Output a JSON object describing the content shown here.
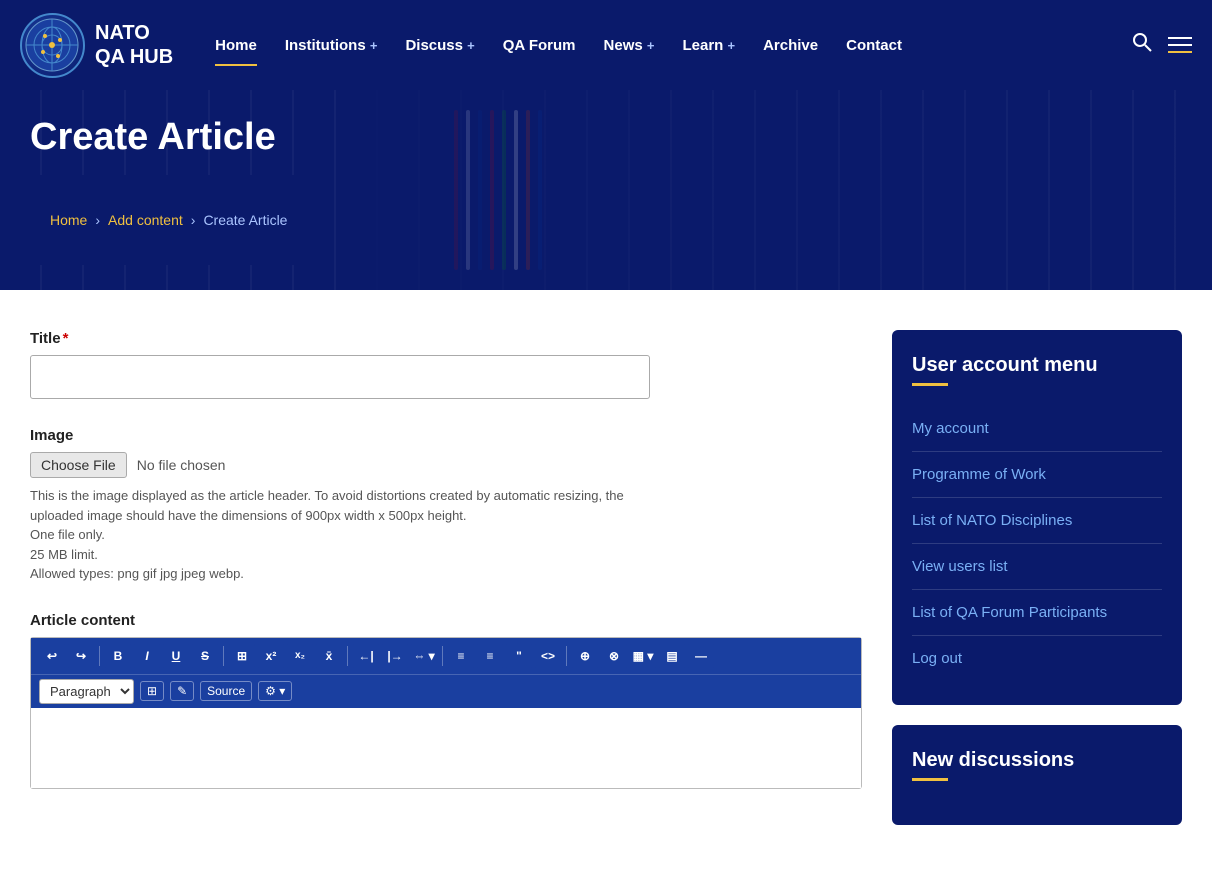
{
  "nav": {
    "logo_text_line1": "NATO",
    "logo_text_line2": "QA  HUB",
    "items": [
      {
        "label": "Home",
        "has_plus": false,
        "active": true
      },
      {
        "label": "Institutions",
        "has_plus": true,
        "active": false
      },
      {
        "label": "Discuss",
        "has_plus": true,
        "active": false
      },
      {
        "label": "QA Forum",
        "has_plus": false,
        "active": false
      },
      {
        "label": "News",
        "has_plus": true,
        "active": false
      },
      {
        "label": "Learn",
        "has_plus": true,
        "active": false
      },
      {
        "label": "Archive",
        "has_plus": false,
        "active": false
      },
      {
        "label": "Contact",
        "has_plus": false,
        "active": false
      }
    ]
  },
  "hero": {
    "title": "Create Article",
    "breadcrumb": [
      {
        "label": "Home",
        "link": true
      },
      {
        "label": ">",
        "link": false
      },
      {
        "label": "Add content",
        "link": true
      },
      {
        "label": ">",
        "link": false
      },
      {
        "label": "Create Article",
        "link": false
      }
    ]
  },
  "form": {
    "title_label": "Title",
    "title_placeholder": "",
    "image_label": "Image",
    "choose_file_btn": "Choose File",
    "no_file_text": "No file chosen",
    "image_help1": "This is the image displayed as the article header. To avoid distortions created by automatic resizing, the uploaded image should have the dimensions of 900px width x 500px height.",
    "image_help2": "One file only.",
    "image_help3": "25 MB limit.",
    "image_help4": "Allowed types: png gif jpg jpeg webp.",
    "article_content_label": "Article content",
    "paragraph_option": "Paragraph"
  },
  "toolbar": {
    "buttons": [
      "↩",
      "↪",
      "B",
      "I",
      "U",
      "S",
      "⊞",
      "x²",
      "x₂",
      "x̄",
      "∫",
      "←|",
      "|→",
      "⇔",
      "≡",
      "≡",
      "\"",
      "<>",
      "⊕",
      "⊗",
      "▦",
      "▤",
      "▮"
    ],
    "source_btn": "Source"
  },
  "sidebar": {
    "user_menu_title": "User account menu",
    "items": [
      {
        "label": "My account",
        "link": true
      },
      {
        "label": "Programme of Work",
        "link": true
      },
      {
        "label": "List of NATO Disciplines",
        "link": true
      },
      {
        "label": "View users list",
        "link": true
      },
      {
        "label": "List of QA Forum Participants",
        "link": true
      },
      {
        "label": "Log out",
        "link": true
      }
    ],
    "new_discussions_title": "New discussions"
  }
}
